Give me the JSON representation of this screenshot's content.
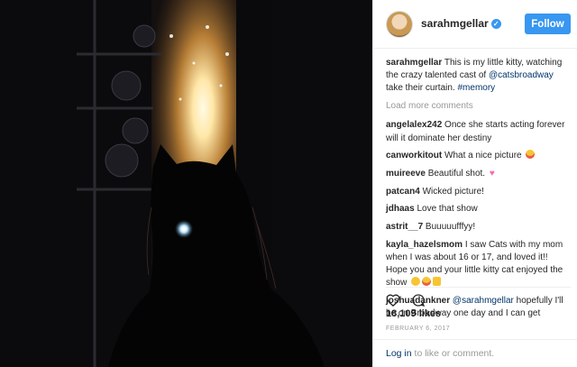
{
  "post": {
    "username": "sarahmgellar",
    "verified": true,
    "follow_label": "Follow",
    "caption": {
      "user": "sarahmgellar",
      "text_before": "This is my little kitty, watching the crazy talented cast of",
      "mention": "@catsbroadway",
      "text_after": "take their curtain.",
      "hashtag": "#memory"
    },
    "load_more": "Load more comments",
    "comments": [
      {
        "user": "angelalex242",
        "text": "Once she starts acting forever will it dominate her destiny"
      },
      {
        "user": "canworkitout",
        "text": "What a nice picture",
        "emoji": "heart-eyes"
      },
      {
        "user": "muireeve",
        "text": "Beautiful shot.",
        "emoji": "pink-heart"
      },
      {
        "user": "patcan4",
        "text": "Wicked picture!"
      },
      {
        "user": "jdhaas",
        "text": "Love that show"
      },
      {
        "user": "astrit__7",
        "text": "Buuuuufffyy!"
      },
      {
        "user": "kayla_hazelsmom",
        "text": "I saw Cats with my mom when I was about 16 or 17, and loved it!! Hope you and your little kitty cat enjoyed the show",
        "emoji": "smile-heart-cat-thumb"
      },
      {
        "user": "joshuadankner",
        "mention": "@sarahmgellar",
        "text": "hopefully I'll be on Broadway one day and I can get"
      }
    ],
    "likes": "18,109 likes",
    "date": "FEBRUARY 6, 2017",
    "login_link": "Log in",
    "login_text": "to like or comment.",
    "icons": [
      "heart-icon",
      "comment-icon",
      "verified-badge-icon"
    ],
    "colors": {
      "accent": "#3897f0",
      "link": "#003569",
      "muted": "#999999",
      "photo_bg": "#0b0b0d"
    }
  }
}
